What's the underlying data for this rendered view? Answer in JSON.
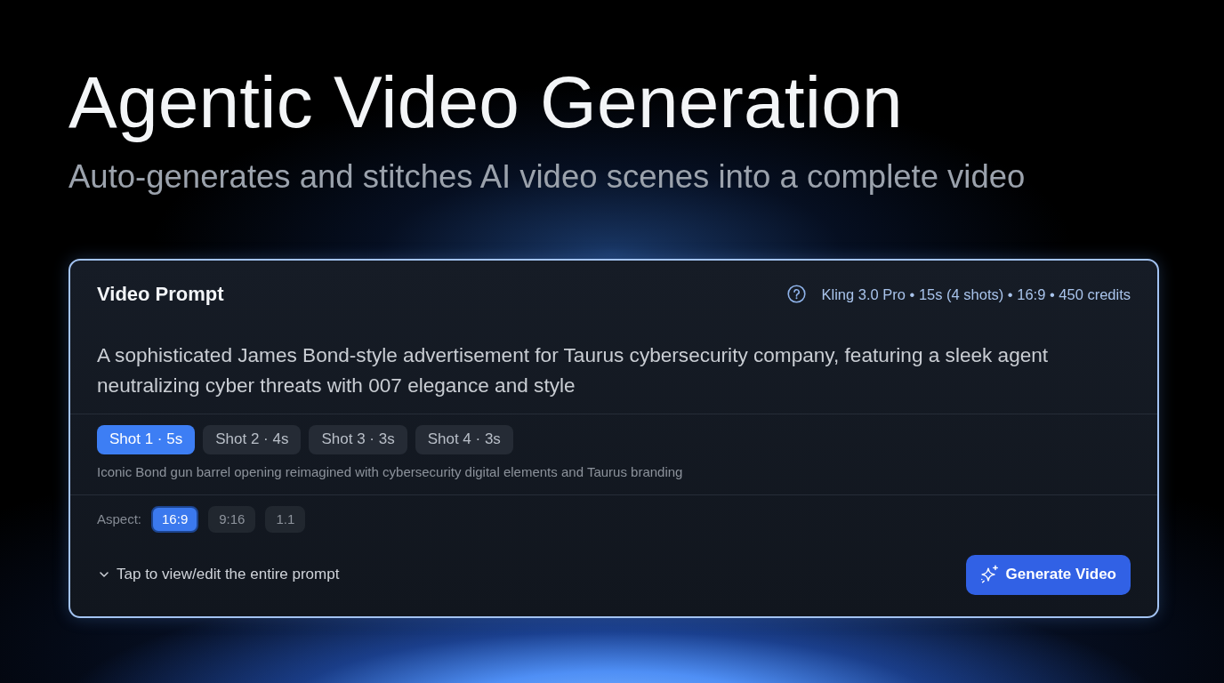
{
  "hero": {
    "title": "Agentic Video Generation",
    "subtitle": "Auto-generates and stitches AI video scenes into a complete video"
  },
  "prompt_card": {
    "title": "Video Prompt",
    "meta": "Kling 3.0 Pro • 15s (4 shots) • 16:9 • 450 credits",
    "prompt": "A sophisticated James Bond-style advertisement for Taurus cybersecurity company, featuring a sleek agent neutralizing cyber threats with 007 elegance and style",
    "shots": [
      {
        "label": "Shot 1 · 5s",
        "selected": true
      },
      {
        "label": "Shot 2 · 4s",
        "selected": false
      },
      {
        "label": "Shot 3 · 3s",
        "selected": false
      },
      {
        "label": "Shot 4 · 3s",
        "selected": false
      }
    ],
    "shot_description": "Iconic Bond gun barrel opening reimagined with cybersecurity digital elements and Taurus branding",
    "aspect": {
      "label": "Aspect:",
      "options": [
        {
          "label": "16:9",
          "selected": true
        },
        {
          "label": "9:16",
          "selected": false
        },
        {
          "label": "1.1",
          "selected": false
        }
      ]
    },
    "expand_toggle": {
      "label": "Tap to view/edit the entire prompt",
      "expanded": false
    },
    "generate_button": "Generate Video"
  }
}
